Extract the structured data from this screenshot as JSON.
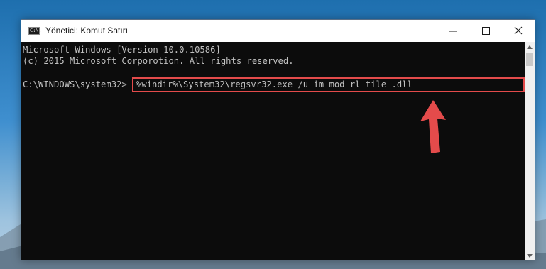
{
  "window": {
    "title": "Yönetici: Komut Satırı",
    "icon_label": "C:\\."
  },
  "console": {
    "lines": [
      "Microsoft Windows [Version 10.0.10586]",
      "(c) 2015 Microsoft Corporotion. All rights reserved."
    ],
    "prompt": "C:\\WINDOWS\\system32>",
    "command": "%windir%\\System32\\regsvr32.exe /u im_mod_rl_tile_.dll"
  },
  "colors": {
    "highlight_box": "#e44b4b",
    "arrow": "#e44b4b",
    "console_bg": "#0c0c0c",
    "console_text": "#c0c0c0"
  },
  "icons": {
    "minimize": "minimize-icon",
    "maximize": "maximize-icon",
    "close": "close-icon",
    "scroll_up": "chevron-up-icon",
    "scroll_down": "chevron-down-icon",
    "annotation": "arrow-up-icon"
  }
}
